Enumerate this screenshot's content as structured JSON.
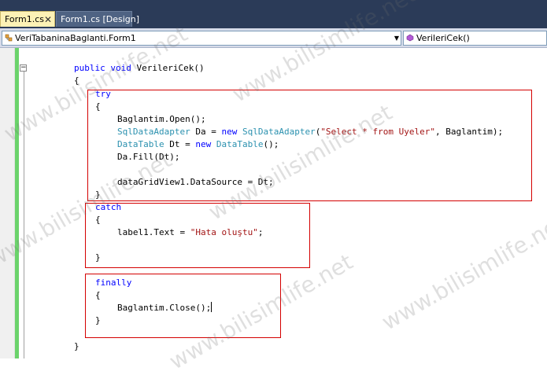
{
  "tabs": [
    {
      "label": "Form1.cs",
      "close": "✕"
    },
    {
      "label": "Form1.cs [Design]"
    }
  ],
  "navbar": {
    "type_combo": "VeriTabaninaBaglanti.Form1",
    "member_combo": "VerileriCek()",
    "dropdown_glyph": "▼"
  },
  "editor": {
    "collapse_glyph": "−",
    "lines": {
      "l1_kw1": "public",
      "l1_kw2": "void",
      "l1_name": "VerileriCek()",
      "l2": "{",
      "l3_try": "try",
      "l4": "{",
      "l5": "Baglantim.Open();",
      "l6_t1": "SqlDataAdapter",
      "l6_a": " Da = ",
      "l6_new": "new",
      "l6_t2": "SqlDataAdapter",
      "l6_b": "(",
      "l6_str": "\"Select * from Uyeler\"",
      "l6_c": ", Baglantim);",
      "l7_t1": "DataTable",
      "l7_a": " Dt = ",
      "l7_new": "new",
      "l7_t2": "DataTable",
      "l7_b": "();",
      "l8": "Da.Fill(Dt);",
      "l10": "dataGridView1.DataSource = Dt;",
      "l11": "}",
      "l12_catch": "catch",
      "l13": "{",
      "l14_a": "label1.Text = ",
      "l14_str": "\"Hata oluştu\"",
      "l14_b": ";",
      "l16": "}",
      "l18_finally": "finally",
      "l19": "{",
      "l20": "Baglantim.Close();",
      "l21": "}",
      "l23": "}"
    }
  },
  "watermark": "www.bilisimlife.net",
  "colors": {
    "keyword": "#0000ff",
    "type": "#2b91af",
    "string": "#a31515",
    "highlight_box": "#d40000",
    "change_bar": "#6bd36b"
  }
}
